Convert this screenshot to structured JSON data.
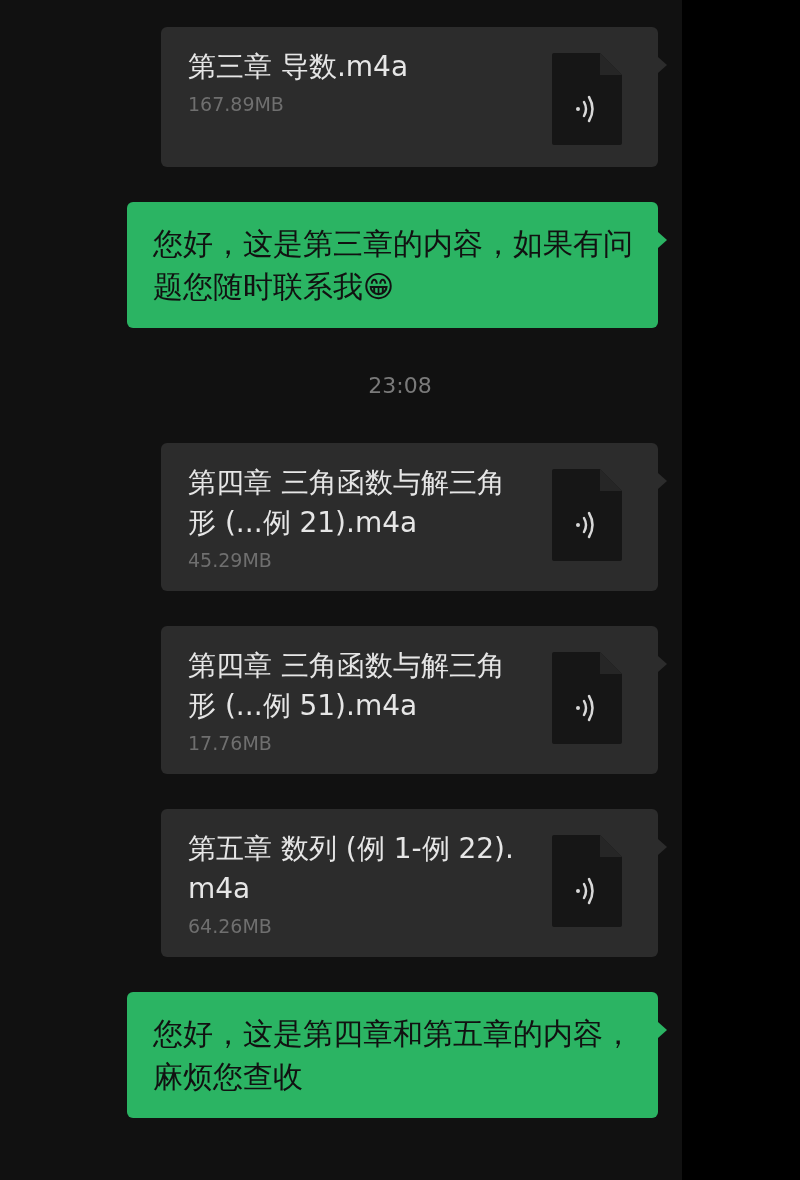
{
  "messages": [
    {
      "kind": "file",
      "name": "第三章 导数.m4a",
      "size": "167.89MB"
    },
    {
      "kind": "text",
      "text": "您好，这是第三章的内容，如果有问题您随时联系我😁"
    },
    {
      "kind": "time",
      "text": "23:08"
    },
    {
      "kind": "file",
      "name": "第四章 三角函数与解三角形 (...例 21).m4a",
      "size": "45.29MB"
    },
    {
      "kind": "file",
      "name": "第四章 三角函数与解三角形 (...例 51).m4a",
      "size": "17.76MB"
    },
    {
      "kind": "file",
      "name": "第五章 数列 (例 1-例 22).m4a",
      "size": "64.26MB"
    },
    {
      "kind": "text",
      "text": "您好，这是第四章和第五章的内容，麻烦您查收"
    }
  ]
}
